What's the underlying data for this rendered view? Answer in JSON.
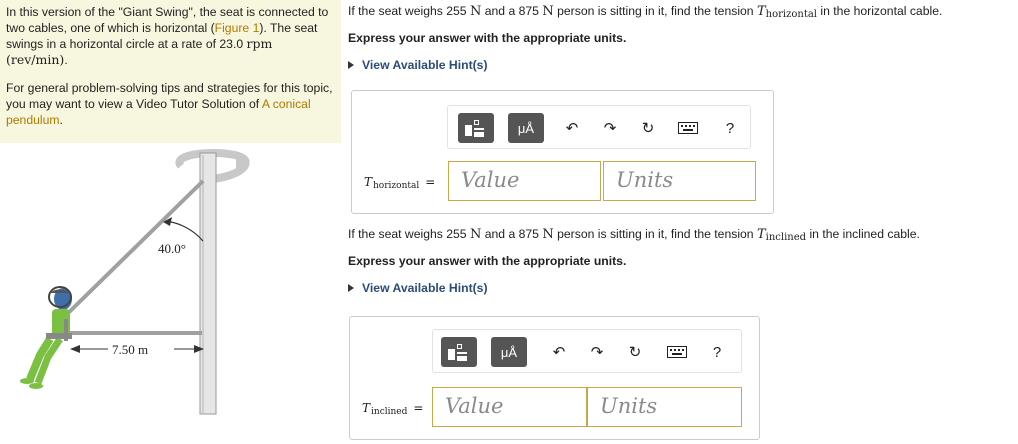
{
  "problem": {
    "para1_a": "In this version of the \"Giant Swing\", the seat is connected to two cables, one of which is horizontal (",
    "figure_link": "Figure 1",
    "para1_b": "). The seat swings in a horizontal circle at a rate of 23.0",
    "rate_unit": "rpm (rev/min)",
    "para1_c": ".",
    "para2": "For general problem-solving tips and strategies for this topic, you may want to view a Video Tutor Solution of",
    "video_link": "A conical pendulum",
    "para2_end": "."
  },
  "figure": {
    "angle_label": "40.0°",
    "radius_label": "7.50 m"
  },
  "part_a": {
    "q_pre": "If the seat weighs 255",
    "q_unit1": "N",
    "q_mid": "and a 875",
    "q_unit2": "N",
    "q_post1": "person is sitting in it, find the tension",
    "q_var": "T",
    "q_sub": "horizontal",
    "q_post2": "in the horizontal cable.",
    "express": "Express your answer with the appropriate units.",
    "hints": "View Available Hint(s)",
    "label_var": "T",
    "label_sub": "horizontal",
    "value_placeholder": "Value",
    "units_placeholder": "Units"
  },
  "part_b": {
    "q_pre": "If the seat weighs 255",
    "q_unit1": "N",
    "q_mid": "and a 875",
    "q_unit2": "N",
    "q_post1": "person is sitting in it, find the tension",
    "q_var": "T",
    "q_sub": "inclined",
    "q_post2": "in the inclined cable.",
    "express": "Express your answer with the appropriate units.",
    "hints": "View Available Hint(s)",
    "label_var": "T",
    "label_sub": "inclined",
    "value_placeholder": "Value",
    "units_placeholder": "Units"
  },
  "toolbar": {
    "units_button": "μÅ",
    "help": "?"
  }
}
